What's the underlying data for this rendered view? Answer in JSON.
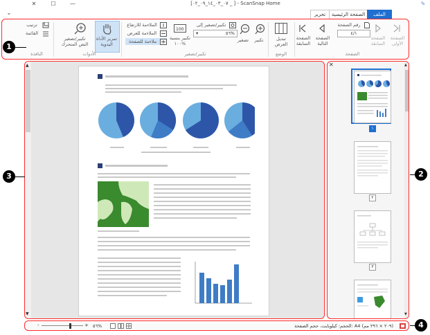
{
  "window": {
    "title": "[٠٧_٠٣_١٤_٠٩_٠٢ _ ] - ScanSnap Home"
  },
  "tabs": [
    {
      "label": "الملف"
    },
    {
      "label": "الصفحة الرئيسية"
    },
    {
      "label": "تحرير"
    }
  ],
  "ribbon": {
    "page_group": {
      "label": "الصفحة",
      "first_page": "الصفحة الأولى",
      "prev_page": "الصفحة السابقة",
      "page_number_label": "رقم الصفحة",
      "page_number_value": "٤/١",
      "prev_page2": "الصفحة السابقة",
      "next_page": "الصفحة التالية",
      "last_page": "الصفحة السابقة"
    },
    "mode_group": {
      "label": "الوضع",
      "toggle_view": "تبديل العرض"
    },
    "zoom_group": {
      "label": "تكبير/تصغير",
      "zoom_in": "تكبير",
      "zoom_out": "تصغير",
      "zoom_to": "تكبير/تصغير إلى",
      "zoom_value": "٥٦%",
      "zoom_100": "تكبير بنسبة ١٠٠%",
      "fit_height": "الملاءمة للارتفاع",
      "fit_width": "الملاءمة للعرض",
      "fit_page": "ملاءمة للصفحة"
    },
    "tools_group": {
      "label": "الأدوات",
      "hand_tool": "تمرير الأداة اليدوية",
      "zoom_move": "تكبير/تصغير النص المتحرك"
    },
    "window_group": {
      "label": "النافذة",
      "arrange": "ترتيب",
      "list": "القائمة"
    }
  },
  "thumbnails": [
    {
      "number": "١"
    },
    {
      "number": "٢"
    },
    {
      "number": "٣"
    }
  ],
  "status": {
    "zoom_value": "٥٦%",
    "info": "الحجم: كيلوبايت، حجم الصفحة: A4 (٢٠٩ × ٢٩٦ مم)"
  },
  "callouts": [
    "1",
    "2",
    "3",
    "4"
  ],
  "colors": {
    "accent": "#1e6fd0",
    "highlight": "#ff2a2a",
    "chart_blue_light": "#6aaee0",
    "chart_blue_dark": "#2e56a8",
    "map_green": "#3a8a2e"
  }
}
